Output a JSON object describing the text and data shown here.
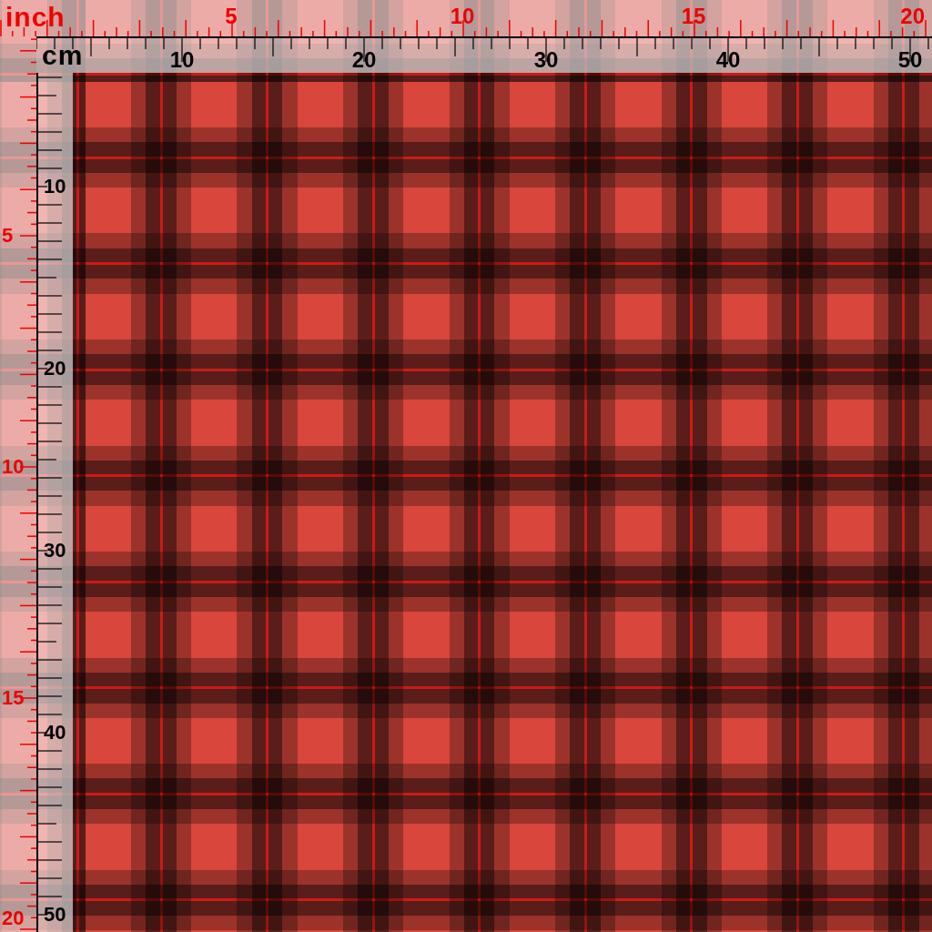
{
  "top_inch_ruler": {
    "unit_label": "inch",
    "labels": [
      "5",
      "10",
      "15",
      "20"
    ]
  },
  "top_cm_ruler": {
    "unit_label": "cm",
    "labels": [
      "10",
      "20",
      "30",
      "40",
      "50"
    ]
  },
  "left_inch_ruler": {
    "labels": [
      "5",
      "10",
      "15",
      "20"
    ]
  },
  "left_cm_ruler": {
    "labels": [
      "10",
      "20",
      "30",
      "40",
      "50"
    ]
  }
}
